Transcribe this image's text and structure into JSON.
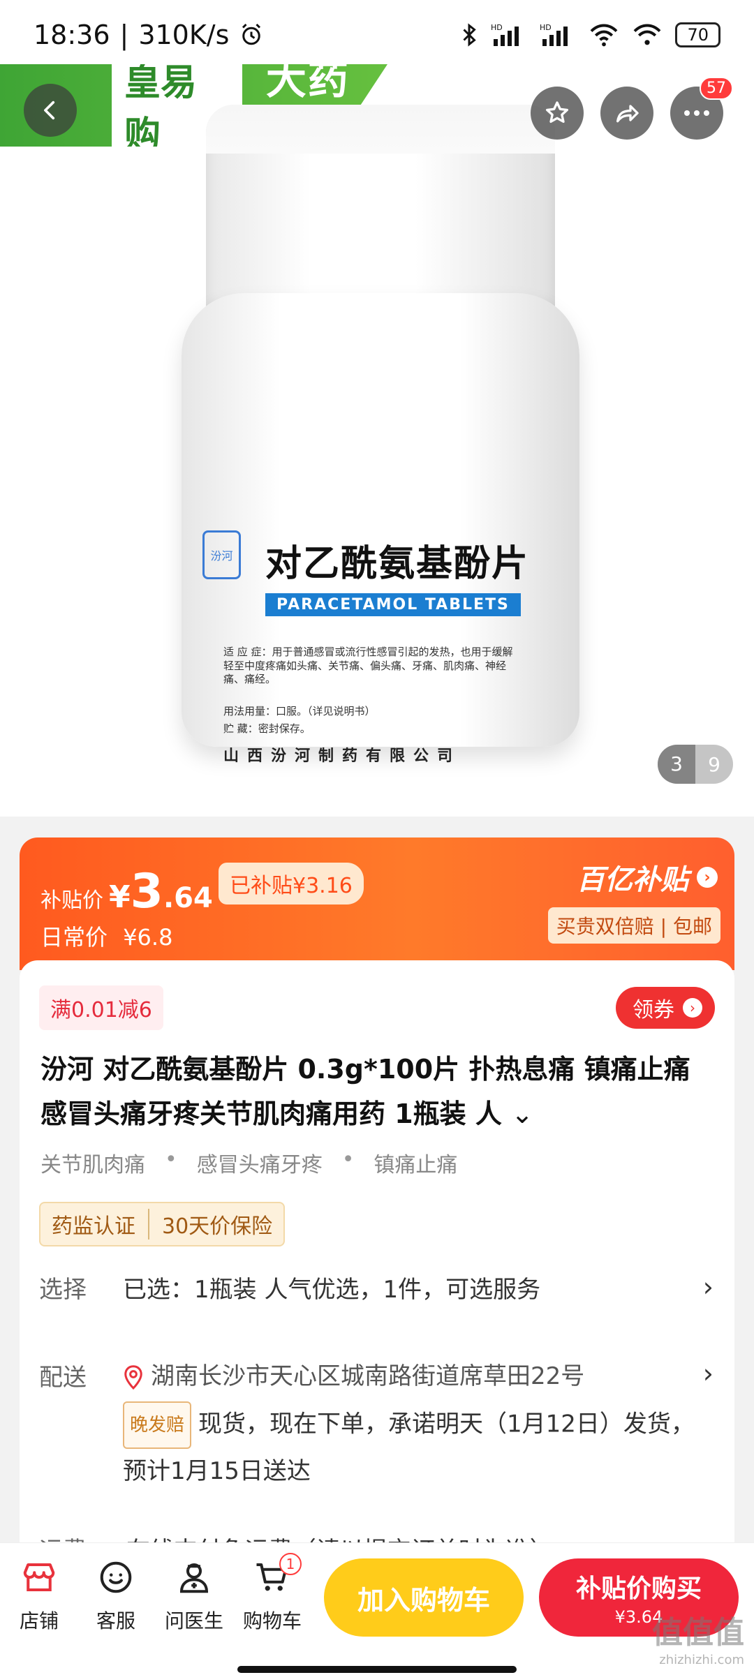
{
  "status_bar": {
    "time": "18:36",
    "speed": "310K/s",
    "battery": "70"
  },
  "hero": {
    "shop_brand": "皇易购",
    "shop_name": "大药房",
    "cart_count_badge": "57",
    "image_page_current": "3",
    "image_page_total": "9",
    "product_label": {
      "title": "对乙酰氨基酚片",
      "english": "PARACETAMOL TABLETS",
      "indication": "适 应 症：用于普通感冒或流行性感冒引起的发热，也用于缓解轻至中度疼痛如头痛、关节痛、偏头痛、牙痛、肌肉痛、神经痛、痛经。",
      "usage": "用法用量：口服。（详见说明书）",
      "storage": "贮  藏：密封保存。",
      "company": "山西汾河制药有限公司"
    }
  },
  "price_banner": {
    "subsidy_label": "补贴价",
    "yen": "¥",
    "price_int": "3",
    "price_dec": ".64",
    "subsidy_tag": "已补贴¥3.16",
    "regular_label": "日常价",
    "regular_price": "¥6.8",
    "program_title": "百亿补贴",
    "program_desc": "买贵双倍赔 | 包邮"
  },
  "product": {
    "coupon_tag": "满0.01减6",
    "coupon_button": "领券",
    "title": "汾河  对乙酰氨基酚片 0.3g*100片 扑热息痛 镇痛止痛 感冒头痛牙疼关节肌肉痛用药 1瓶装 人",
    "tags": [
      "关节肌肉痛",
      "感冒头痛牙疼",
      "镇痛止痛"
    ],
    "cert_1": "药监认证",
    "cert_2": "30天价保险",
    "select_label": "选择",
    "select_value": "已选：1瓶装 人气优选，1件，可选服务",
    "delivery_label": "配送",
    "delivery_address": "湖南长沙市天心区城南路街道席草田22号",
    "late_tag": "晚发赔",
    "delivery_detail": "现货，现在下单，承诺明天（1月12日）发货，预计1月15日送达",
    "freight_label": "运费",
    "freight_value": "在线支付免运费（请以提交订单时为准）"
  },
  "bottom_bar": {
    "store": "店铺",
    "service": "客服",
    "doctor": "问医生",
    "cart": "购物车",
    "cart_badge": "1",
    "add_to_cart": "加入购物车",
    "buy_label": "补贴价购买",
    "buy_price": "¥3.64"
  },
  "watermark": {
    "main": "值值值",
    "sub": "zhizhizhi.com"
  }
}
